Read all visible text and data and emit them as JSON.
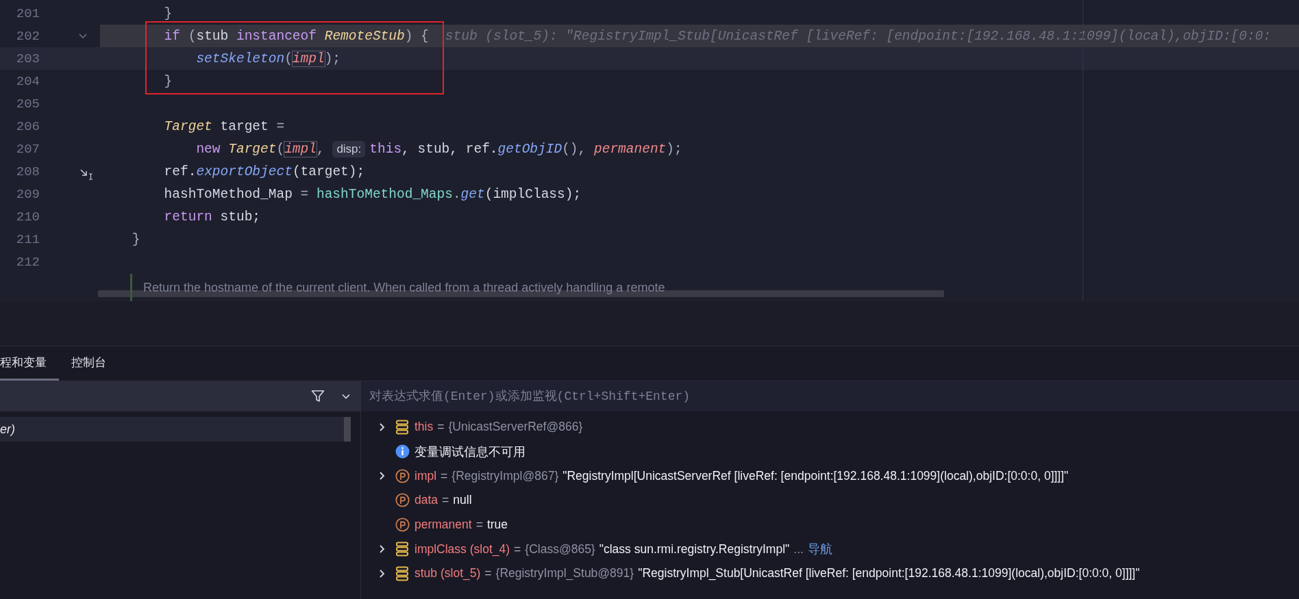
{
  "editor": {
    "lines": [
      {
        "number": "201",
        "execution_point": false,
        "caret_line": false,
        "foldable": false,
        "gutter_icon": false,
        "tokens": [
          {
            "text": "        }",
            "kind": "punct",
            "boxed": false
          }
        ]
      },
      {
        "number": "202",
        "execution_point": true,
        "caret_line": false,
        "foldable": true,
        "gutter_icon": false,
        "tokens": [
          {
            "text": "        if",
            "kind": "keyword",
            "boxed": false
          },
          {
            "text": " (",
            "kind": "punct",
            "boxed": false
          },
          {
            "text": "stub ",
            "kind": "plain",
            "boxed": false
          },
          {
            "text": "instanceof ",
            "kind": "keyword",
            "boxed": false
          },
          {
            "text": "RemoteStub",
            "kind": "type",
            "boxed": false
          },
          {
            "text": ") {",
            "kind": "punct",
            "boxed": false
          }
        ],
        "inline_value": "stub (slot_5): \"RegistryImpl_Stub[UnicastRef [liveRef: [endpoint:[192.168.48.1:1099](local),objID:[0:0:"
      },
      {
        "number": "203",
        "execution_point": false,
        "caret_line": true,
        "foldable": false,
        "gutter_icon": false,
        "tokens": [
          {
            "text": "            setSkeleton",
            "kind": "method",
            "boxed": false
          },
          {
            "text": "(",
            "kind": "punct",
            "boxed": false
          },
          {
            "text": "impl",
            "kind": "param",
            "boxed": true
          },
          {
            "text": ");",
            "kind": "punct",
            "boxed": false
          }
        ]
      },
      {
        "number": "204",
        "execution_point": false,
        "caret_line": false,
        "foldable": false,
        "gutter_icon": false,
        "tokens": [
          {
            "text": "        }",
            "kind": "punct",
            "boxed": false
          }
        ]
      },
      {
        "number": "205",
        "execution_point": false,
        "caret_line": false,
        "foldable": false,
        "gutter_icon": false
      },
      {
        "number": "206",
        "execution_point": false,
        "caret_line": false,
        "foldable": false,
        "gutter_icon": false,
        "tokens": [
          {
            "text": "        Target",
            "kind": "type",
            "boxed": false
          },
          {
            "text": " target ",
            "kind": "plain",
            "boxed": false
          },
          {
            "text": "=",
            "kind": "punct",
            "boxed": false
          }
        ]
      },
      {
        "number": "207",
        "execution_point": false,
        "caret_line": false,
        "foldable": false,
        "gutter_icon": false,
        "tokens": [
          {
            "text": "            new ",
            "kind": "keyword",
            "boxed": false
          },
          {
            "text": "Target",
            "kind": "type",
            "boxed": false
          },
          {
            "text": "(",
            "kind": "punct",
            "boxed": false
          },
          {
            "text": "impl",
            "kind": "param",
            "boxed": true
          },
          {
            "text": ", ",
            "kind": "punct",
            "boxed": false
          },
          {
            "text": "disp:",
            "kind": "hint"
          },
          {
            "text": "this",
            "kind": "keyword",
            "boxed": false
          },
          {
            "text": ", stub, ref.",
            "kind": "plain",
            "boxed": false
          },
          {
            "text": "getObjID",
            "kind": "method",
            "boxed": false
          },
          {
            "text": "(), ",
            "kind": "punct",
            "boxed": false
          },
          {
            "text": "permanent",
            "kind": "param",
            "boxed": false
          },
          {
            "text": ");",
            "kind": "punct",
            "boxed": false
          }
        ]
      },
      {
        "number": "208",
        "execution_point": false,
        "caret_line": false,
        "foldable": false,
        "gutter_icon": true,
        "tokens": [
          {
            "text": "        ref.",
            "kind": "plain",
            "boxed": false
          },
          {
            "text": "exportObject",
            "kind": "method",
            "boxed": false
          },
          {
            "text": "(target);",
            "kind": "plain",
            "boxed": false
          }
        ]
      },
      {
        "number": "209",
        "execution_point": false,
        "caret_line": false,
        "foldable": false,
        "gutter_icon": false,
        "tokens": [
          {
            "text": "        hashToMethod_Map ",
            "kind": "plain",
            "boxed": false
          },
          {
            "text": "= ",
            "kind": "punct",
            "boxed": false
          },
          {
            "text": "hashToMethod_Maps",
            "kind": "static",
            "boxed": false
          },
          {
            "text": ".",
            "kind": "punct",
            "boxed": false
          },
          {
            "text": "get",
            "kind": "method",
            "boxed": false
          },
          {
            "text": "(implClass);",
            "kind": "plain",
            "boxed": false
          }
        ]
      },
      {
        "number": "210",
        "execution_point": false,
        "caret_line": false,
        "foldable": false,
        "gutter_icon": false,
        "tokens": [
          {
            "text": "        return ",
            "kind": "keyword",
            "boxed": false
          },
          {
            "text": "stub;",
            "kind": "plain",
            "boxed": false
          }
        ]
      },
      {
        "number": "211",
        "execution_point": false,
        "caret_line": false,
        "foldable": false,
        "gutter_icon": false,
        "tokens": [
          {
            "text": "    }",
            "kind": "punct",
            "boxed": false
          }
        ]
      },
      {
        "number": "212",
        "execution_point": false,
        "caret_line": false,
        "foldable": false,
        "gutter_icon": false
      }
    ],
    "doc_text": "Return the hostname of the current client. When called from a thread actively handling a remote"
  },
  "debug_panel": {
    "tabs": [
      {
        "label": "程和变量",
        "selected": true
      },
      {
        "label": "控制台",
        "selected": false
      }
    ],
    "frames": [
      {
        "label": "er)",
        "selected": true
      }
    ],
    "evaluate_placeholder": "对表达式求值(Enter)或添加监视(Ctrl+Shift+Enter)",
    "variables": [
      {
        "kind": "field",
        "expandable": true,
        "name": "this",
        "equals": "=",
        "type": "{UnicastServerRef@866}"
      },
      {
        "kind": "info",
        "expandable": false,
        "message": "变量调试信息不可用"
      },
      {
        "kind": "param",
        "expandable": true,
        "name": "impl",
        "equals": "=",
        "type": "{RegistryImpl@867}",
        "value": "\"RegistryImpl[UnicastServerRef [liveRef: [endpoint:[192.168.48.1:1099](local),objID:[0:0:0, 0]]]]\""
      },
      {
        "kind": "param",
        "expandable": false,
        "name": "data",
        "equals": "=",
        "value": "null"
      },
      {
        "kind": "param",
        "expandable": false,
        "name": "permanent",
        "equals": "=",
        "value": "true"
      },
      {
        "kind": "field",
        "expandable": true,
        "name": "implClass (slot_4)",
        "equals": "=",
        "type": "{Class@865}",
        "value": "\"class sun.rmi.registry.RegistryImpl\"",
        "more": "...",
        "link": "导航"
      },
      {
        "kind": "field",
        "expandable": true,
        "name": "stub (slot_5)",
        "equals": "=",
        "type": "{RegistryImpl_Stub@891}",
        "value": "\"RegistryImpl_Stub[UnicastRef [liveRef: [endpoint:[192.168.48.1:1099](local),objID:[0:0:0, 0]]]]\""
      }
    ]
  }
}
